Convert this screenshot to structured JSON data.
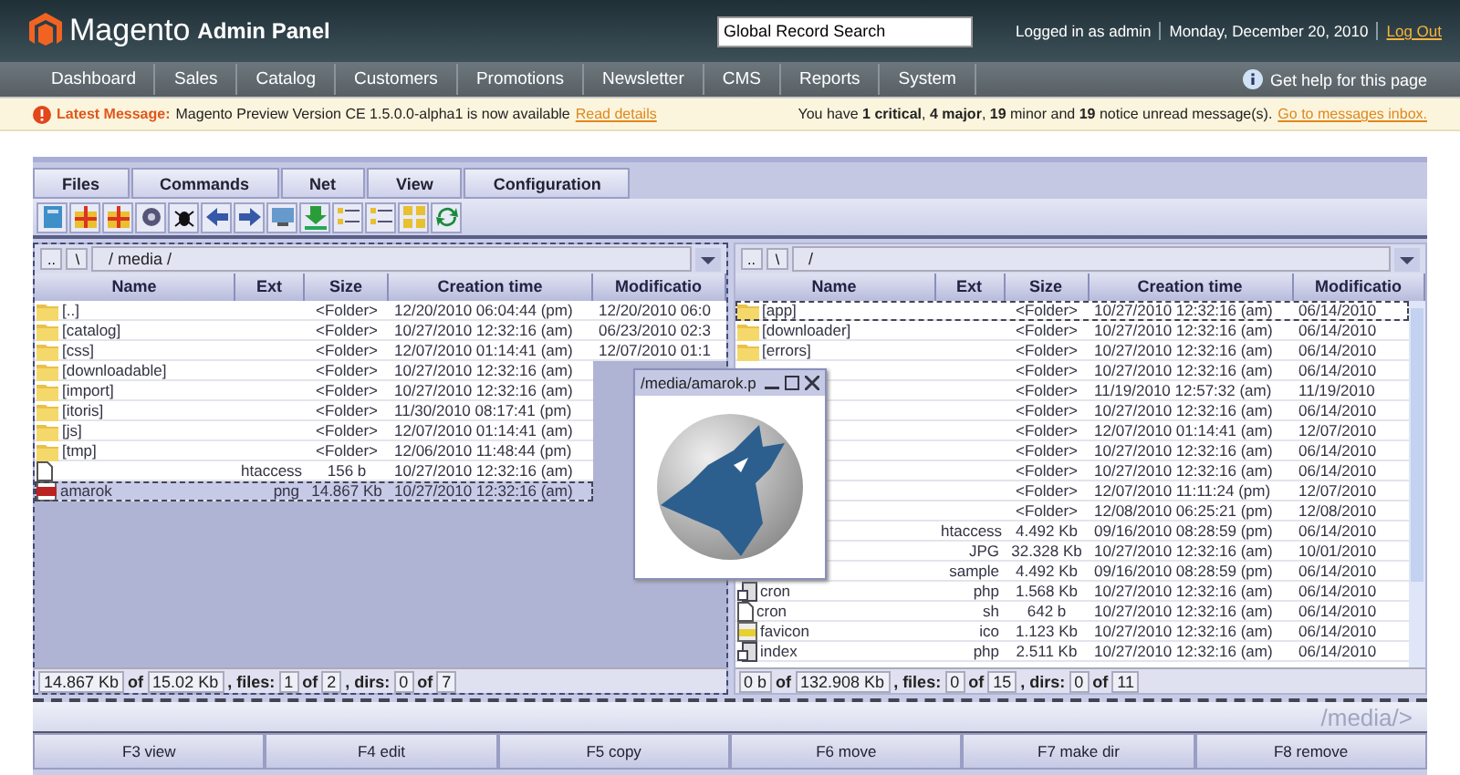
{
  "header": {
    "logo_text": "Magento",
    "logo_suffix": "Admin Panel",
    "search": {
      "value": "Global Record Search"
    },
    "user": "Logged in as admin",
    "date": "Monday, December 20, 2010",
    "logout": "Log Out"
  },
  "nav": {
    "items": [
      "Dashboard",
      "Sales",
      "Catalog",
      "Customers",
      "Promotions",
      "Newsletter",
      "CMS",
      "Reports",
      "System"
    ],
    "help": "Get help for this page"
  },
  "message": {
    "label": "Latest Message:",
    "text": "Magento Preview Version CE 1.5.0.0-alpha1 is now available",
    "link": "Read details",
    "summary": "You have **1 critical**, **4 major**, **19** minor and **19** notice unread message(s).",
    "summary_link": "Go to messages inbox."
  },
  "menu_tabs": [
    "Files",
    "Commands",
    "Net",
    "View",
    "Configuration"
  ],
  "panes": [
    {
      "active": true,
      "path_buttons": [
        "..",
        "\\"
      ],
      "path": "/ media /",
      "columns": [
        "Name",
        "Ext",
        "Size",
        "Creation time",
        "Modificatio"
      ],
      "rows": [
        {
          "kind": "folder",
          "name": "[..]",
          "size": "<Folder>",
          "created": "12/20/2010 06:04:44 (pm)",
          "modified": "12/20/2010 06:0",
          "selected": false,
          "cursor": false
        },
        {
          "kind": "folder",
          "name": "[catalog]",
          "size": "<Folder>",
          "created": "10/27/2010 12:32:16 (am)",
          "modified": "06/23/2010 02:3",
          "selected": false,
          "cursor": false
        },
        {
          "kind": "folder",
          "name": "[css]",
          "size": "<Folder>",
          "created": "12/07/2010 01:14:41 (am)",
          "modified": "12/07/2010 01:1",
          "selected": false,
          "cursor": false
        },
        {
          "kind": "folder",
          "name": "[downloadable]",
          "size": "<Folder>",
          "created": "10/27/2010 12:32:16 (am)",
          "selected": false,
          "cursor": false
        },
        {
          "kind": "folder",
          "name": "[import]",
          "size": "<Folder>",
          "created": "10/27/2010 12:32:16 (am)",
          "selected": false,
          "cursor": false
        },
        {
          "kind": "folder",
          "name": "[itoris]",
          "size": "<Folder>",
          "created": "11/30/2010 08:17:41 (pm)",
          "selected": false,
          "cursor": false
        },
        {
          "kind": "folder",
          "name": "[js]",
          "size": "<Folder>",
          "created": "12/07/2010 01:14:41 (am)",
          "selected": false,
          "cursor": false
        },
        {
          "kind": "folder",
          "name": "[tmp]",
          "size": "<Folder>",
          "created": "12/06/2010 11:48:44 (pm)",
          "selected": false,
          "cursor": false
        },
        {
          "kind": "file",
          "ext": "htaccess",
          "size": "156 b",
          "created": "10/27/2010 12:32:16 (am)",
          "selected": false,
          "cursor": false
        },
        {
          "kind": "image",
          "name": "amarok",
          "ext": "png",
          "size": "14.867 Kb",
          "created": "10/27/2010 12:32:16 (am)",
          "selected": true,
          "cursor": true
        }
      ],
      "status": [
        {
          "kind": "value",
          "text": "14.867 Kb"
        },
        {
          "kind": "label",
          "text": "of"
        },
        {
          "kind": "value",
          "text": "15.02 Kb"
        },
        {
          "kind": "label",
          "text": ", files:"
        },
        {
          "kind": "value",
          "text": "1"
        },
        {
          "kind": "label",
          "text": "of"
        },
        {
          "kind": "value",
          "text": "2"
        },
        {
          "kind": "label",
          "text": ", dirs:"
        },
        {
          "kind": "value",
          "text": "0"
        },
        {
          "kind": "label",
          "text": "of"
        },
        {
          "kind": "value",
          "text": "7"
        }
      ]
    },
    {
      "active": false,
      "path_buttons": [
        "..",
        "\\"
      ],
      "path": "/",
      "columns": [
        "Name",
        "Ext",
        "Size",
        "Creation time",
        "Modificatio"
      ],
      "rows": [
        {
          "kind": "folder",
          "name": "[app]",
          "size": "<Folder>",
          "created": "10/27/2010 12:32:16 (am)",
          "modified": "06/14/2010",
          "selected": false,
          "cursor": true
        },
        {
          "kind": "folder",
          "name": "[downloader]",
          "size": "<Folder>",
          "created": "10/27/2010 12:32:16 (am)",
          "modified": "06/14/2010",
          "selected": false,
          "cursor": false
        },
        {
          "kind": "folder",
          "name": "[errors]",
          "size": "<Folder>",
          "created": "10/27/2010 12:32:16 (am)",
          "modified": "06/14/2010",
          "selected": false,
          "cursor": false
        },
        {
          "kind": "hidden",
          "size": "<Folder>",
          "created": "10/27/2010 12:32:16 (am)",
          "modified": "06/14/2010",
          "selected": false,
          "cursor": false
        },
        {
          "kind": "hidden",
          "size": "<Folder>",
          "created": "11/19/2010 12:57:32 (am)",
          "modified": "11/19/2010",
          "selected": false,
          "cursor": false
        },
        {
          "kind": "hidden",
          "size": "<Folder>",
          "created": "10/27/2010 12:32:16 (am)",
          "modified": "06/14/2010",
          "selected": false,
          "cursor": false
        },
        {
          "kind": "hidden",
          "size": "<Folder>",
          "created": "12/07/2010 01:14:41 (am)",
          "modified": "12/07/2010",
          "selected": false,
          "cursor": false
        },
        {
          "kind": "hidden",
          "size": "<Folder>",
          "created": "10/27/2010 12:32:16 (am)",
          "modified": "06/14/2010",
          "selected": false,
          "cursor": false
        },
        {
          "kind": "hidden",
          "size": "<Folder>",
          "created": "10/27/2010 12:32:16 (am)",
          "modified": "06/14/2010",
          "selected": false,
          "cursor": false
        },
        {
          "kind": "hidden",
          "size": "<Folder>",
          "created": "12/07/2010 11:11:24 (pm)",
          "modified": "12/07/2010",
          "selected": false,
          "cursor": false
        },
        {
          "kind": "hidden",
          "size": "<Folder>",
          "created": "12/08/2010 06:25:21 (pm)",
          "modified": "12/08/2010",
          "selected": false,
          "cursor": false
        },
        {
          "kind": "hidden",
          "ext": "htaccess",
          "size": "4.492 Kb",
          "created": "09/16/2010 08:28:59 (pm)",
          "modified": "06/14/2010",
          "selected": false,
          "cursor": false
        },
        {
          "kind": "hidden",
          "ext": "JPG",
          "size": "32.328 Kb",
          "created": "10/27/2010 12:32:16 (am)",
          "modified": "10/01/2010",
          "selected": false,
          "cursor": false
        },
        {
          "kind": "hidden",
          "ext": "sample",
          "size": "4.492 Kb",
          "created": "09/16/2010 08:28:59 (pm)",
          "modified": "06/14/2010",
          "selected": false,
          "cursor": false
        },
        {
          "kind": "script",
          "name": "cron",
          "ext": "php",
          "size": "1.568 Kb",
          "created": "10/27/2010 12:32:16 (am)",
          "modified": "06/14/2010",
          "selected": false,
          "cursor": false
        },
        {
          "kind": "file",
          "name": "cron",
          "ext": "sh",
          "size": "642 b",
          "created": "10/27/2010 12:32:16 (am)",
          "modified": "06/14/2010",
          "selected": false,
          "cursor": false
        },
        {
          "kind": "icon",
          "name": "favicon",
          "ext": "ico",
          "size": "1.123 Kb",
          "created": "10/27/2010 12:32:16 (am)",
          "modified": "06/14/2010",
          "selected": false,
          "cursor": false
        },
        {
          "kind": "script",
          "name": "index",
          "ext": "php",
          "size": "2.511 Kb",
          "created": "10/27/2010 12:32:16 (am)",
          "modified": "06/14/2010",
          "selected": false,
          "cursor": false
        }
      ],
      "status": [
        {
          "kind": "value",
          "text": "0 b"
        },
        {
          "kind": "label",
          "text": "of"
        },
        {
          "kind": "value",
          "text": "132.908 Kb"
        },
        {
          "kind": "label",
          "text": ", files:"
        },
        {
          "kind": "value",
          "text": "0"
        },
        {
          "kind": "label",
          "text": "of"
        },
        {
          "kind": "value",
          "text": "15"
        },
        {
          "kind": "label",
          "text": ", dirs:"
        },
        {
          "kind": "value",
          "text": "0"
        },
        {
          "kind": "label",
          "text": "of"
        },
        {
          "kind": "value",
          "text": "11"
        }
      ]
    }
  ],
  "preview": {
    "title": "/media/amarok.p"
  },
  "command": {
    "prompt": "/media/>"
  },
  "function_keys": [
    "F3 view",
    "F4 edit",
    "F5 copy",
    "F6 move",
    "F7 make dir",
    "F8 remove"
  ]
}
